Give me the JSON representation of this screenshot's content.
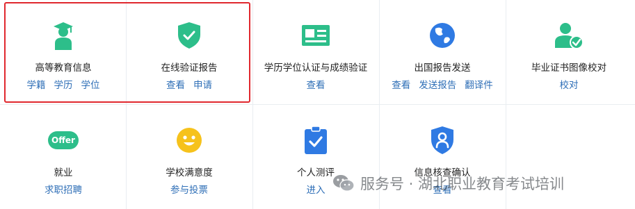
{
  "colors": {
    "icon_green": "#2dbe8a",
    "icon_blue": "#2f7ae3",
    "icon_yellow": "#f6c21c",
    "link_blue": "#2f6fb7",
    "highlight_red": "#e0282e"
  },
  "tiles": [
    {
      "title": "高等教育信息",
      "icon": "graduate-icon",
      "links": [
        "学籍",
        "学历",
        "学位"
      ]
    },
    {
      "title": "在线验证报告",
      "icon": "shield-check-icon",
      "links": [
        "查看",
        "申请"
      ]
    },
    {
      "title": "学历学位认证与成绩验证",
      "icon": "id-card-icon",
      "links": [
        "查看"
      ]
    },
    {
      "title": "出国报告发送",
      "icon": "globe-icon",
      "links": [
        "查看",
        "发送报告",
        "翻译件"
      ]
    },
    {
      "title": "毕业证书图像校对",
      "icon": "user-check-icon",
      "links": [
        "校对"
      ]
    },
    {
      "title": "就业",
      "icon": "offer-icon",
      "icon_text": "Offer",
      "links": [
        "求职招聘"
      ]
    },
    {
      "title": "学校满意度",
      "icon": "smiley-icon",
      "links": [
        "参与投票"
      ]
    },
    {
      "title": "个人测评",
      "icon": "clipboard-check-icon",
      "links": [
        "进入"
      ]
    },
    {
      "title": "信息核查确认",
      "icon": "shield-user-icon",
      "links": [
        "查看"
      ]
    }
  ],
  "watermark": {
    "text": "服务号 · 湖北职业教育考试培训",
    "icon": "wechat-icon"
  }
}
